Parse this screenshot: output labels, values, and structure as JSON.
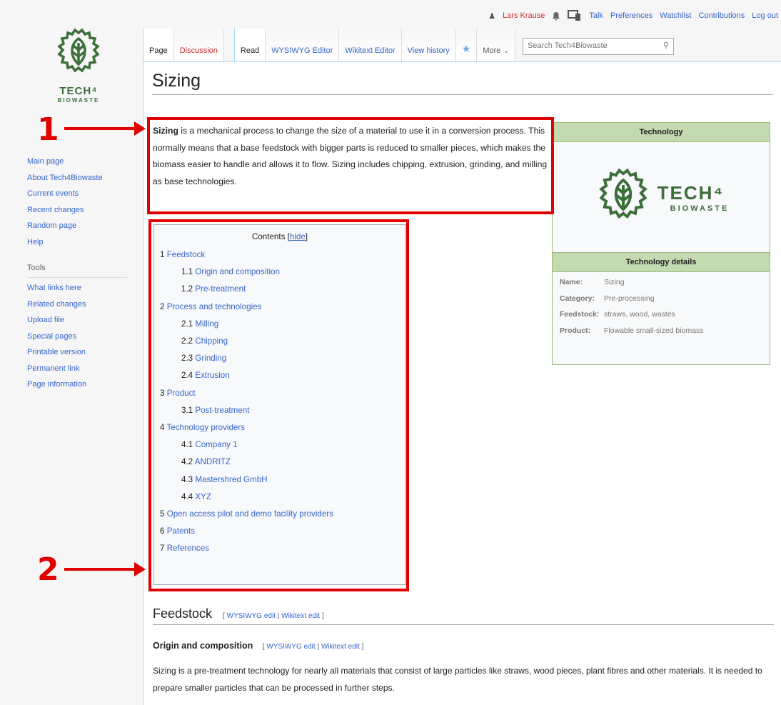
{
  "personal": {
    "user": "Lars Krause",
    "links": [
      "Talk",
      "Preferences",
      "Watchlist",
      "Contributions",
      "Log out"
    ]
  },
  "logo": {
    "line1": "TECH⁴",
    "line2": "BIOWASTE"
  },
  "sidebar": {
    "nav": [
      "Main page",
      "About Tech4Biowaste",
      "Current events",
      "Recent changes",
      "Random page",
      "Help"
    ],
    "tools_heading": "Tools",
    "tools": [
      "What links here",
      "Related changes",
      "Upload file",
      "Special pages",
      "Printable version",
      "Permanent link",
      "Page information"
    ]
  },
  "tabs": {
    "page": "Page",
    "discussion": "Discussion",
    "read": "Read",
    "wysiwyg": "WYSIWYG Editor",
    "wikitext": "Wikitext Editor",
    "history": "View history",
    "more": "More"
  },
  "search": {
    "placeholder": "Search Tech4Biowaste"
  },
  "article": {
    "title": "Sizing",
    "intro_bold": "Sizing",
    "intro_rest": " is a mechanical process to change the size of a material to use it in a conversion process. This normally means that a base feedstock with bigger parts is reduced to smaller pieces, which makes the biomass easier to handle and allows it to flow. Sizing includes chipping, extrusion, grinding, and milling as base technologies."
  },
  "toc": {
    "title": "Contents",
    "hide": "hide",
    "items": [
      {
        "num": "1",
        "label": "Feedstock",
        "level": 1
      },
      {
        "num": "1.1",
        "label": "Origin and composition",
        "level": 2
      },
      {
        "num": "1.2",
        "label": "Pre-treatment",
        "level": 2
      },
      {
        "num": "2",
        "label": "Process and technologies",
        "level": 1
      },
      {
        "num": "2.1",
        "label": "Milling",
        "level": 2
      },
      {
        "num": "2.2",
        "label": "Chipping",
        "level": 2
      },
      {
        "num": "2.3",
        "label": "Grinding",
        "level": 2
      },
      {
        "num": "2.4",
        "label": "Extrusion",
        "level": 2
      },
      {
        "num": "3",
        "label": "Product",
        "level": 1
      },
      {
        "num": "3.1",
        "label": "Post-treatment",
        "level": 2
      },
      {
        "num": "4",
        "label": "Technology providers",
        "level": 1
      },
      {
        "num": "4.1",
        "label": "Company 1",
        "level": 2
      },
      {
        "num": "4.2",
        "label": "ANDRITZ",
        "level": 2
      },
      {
        "num": "4.3",
        "label": "Mastershred GmbH",
        "level": 2
      },
      {
        "num": "4.4",
        "label": "XYZ",
        "level": 2
      },
      {
        "num": "5",
        "label": "Open access pilot and demo facility providers",
        "level": 1
      },
      {
        "num": "6",
        "label": "Patents",
        "level": 1
      },
      {
        "num": "7",
        "label": "References",
        "level": 1
      }
    ]
  },
  "infobox": {
    "header": "Technology",
    "logo1": "TECH⁴",
    "logo2": "BIOWASTE",
    "details_header": "Technology details",
    "rows": [
      {
        "k": "Name:",
        "v": "Sizing"
      },
      {
        "k": "Category:",
        "v": "Pre-processing"
      },
      {
        "k": "Feedstock:",
        "v": "straws, wood, wastes"
      },
      {
        "k": "Product:",
        "v": "Flowable small-sized biomass"
      }
    ]
  },
  "sections": {
    "h2": "Feedstock",
    "h3": "Origin and composition",
    "edit_wysiwyg": "WYSIWYG edit",
    "edit_wikitext": "Wikitext edit",
    "para": "Sizing is a pre-treatment technology for nearly all materials that consist of large particles like straws, wood pieces, plant fibres and other materials. It is needed to prepare smaller particles that can be processed in further steps."
  },
  "annotations": {
    "one": "1",
    "two": "2"
  },
  "colors": {
    "brand_green": "#3d6f3a",
    "annotation_red": "#e00000",
    "link": "#3366cc"
  }
}
